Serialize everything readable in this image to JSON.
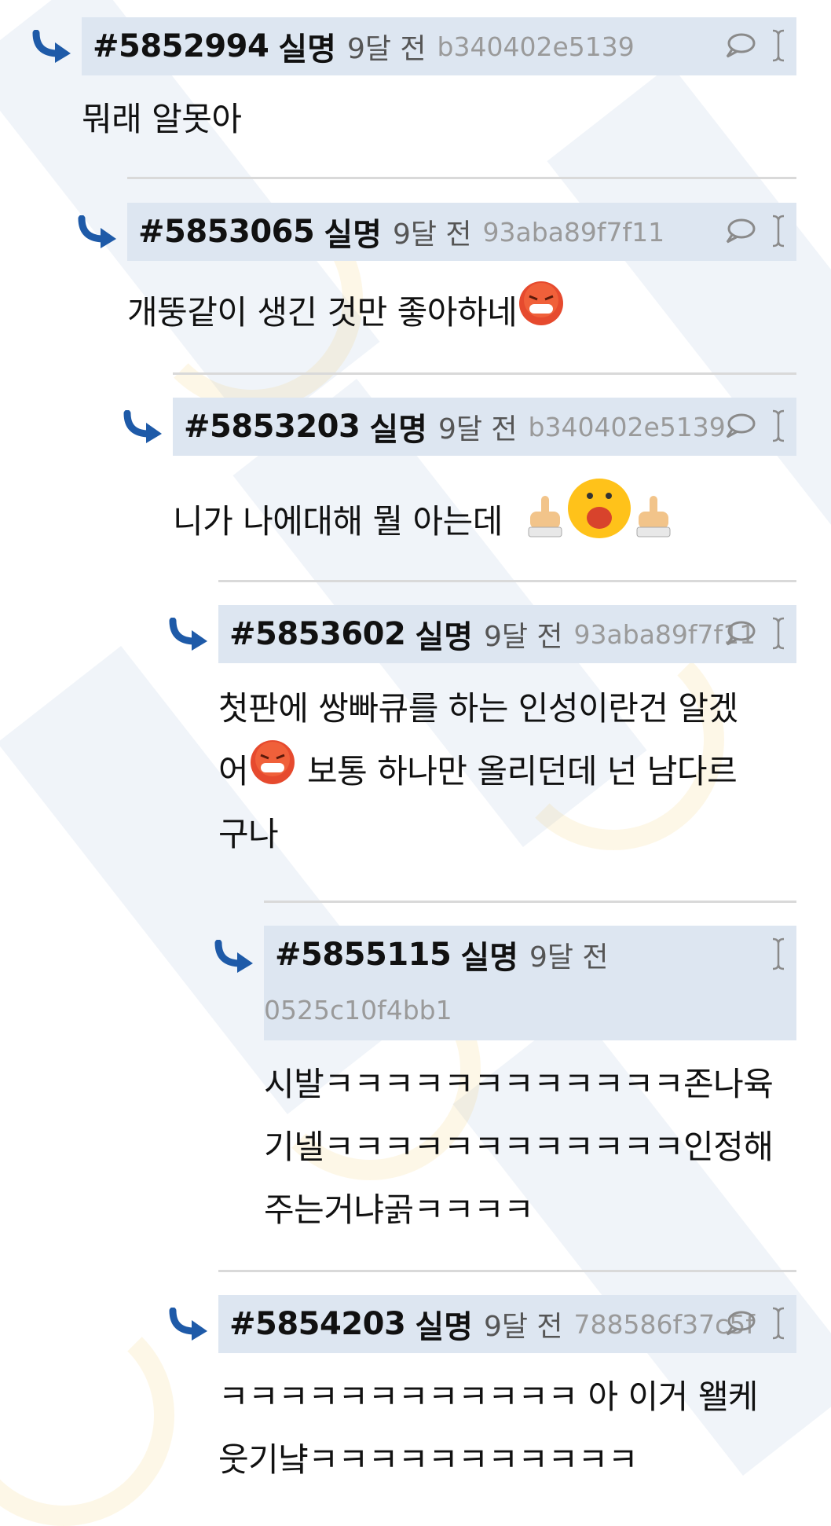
{
  "comments": [
    {
      "id": "#5852994",
      "author": "실명",
      "time": "9달 전",
      "hash": "b340402e5139",
      "text": "뭐래 알못아"
    },
    {
      "id": "#5853065",
      "author": "실명",
      "time": "9달 전",
      "hash": "93aba89f7f11",
      "text": "개뚱같이 생긴 것만 좋아하네"
    },
    {
      "id": "#5853203",
      "author": "실명",
      "time": "9달 전",
      "hash": "b340402e5139",
      "text": "니가 나에대해 뭘 아는데"
    },
    {
      "id": "#5853602",
      "author": "실명",
      "time": "9달 전",
      "hash": "93aba89f7f11",
      "text_line1": "첫판에 쌍빠큐를 하는 인성이란건 알겠",
      "text_line2a": "어",
      "text_line2b": " 보통 하나만 올리던데 넌 남다르",
      "text_line3": "구나"
    },
    {
      "id": "#5855115",
      "author": "실명",
      "time": "9달 전",
      "hash": "0525c10f4bb1",
      "text_line1": "시발ㅋㅋㅋㅋㅋㅋㅋㅋㅋㅋㅋㅋ존나육",
      "text_line2": "기넬ㅋㅋㅋㅋㅋㅋㅋㅋㅋㅋㅋㅋ인정해",
      "text_line3": "주는거냐곩ㅋㅋㅋㅋ"
    },
    {
      "id": "#5854203",
      "author": "실명",
      "time": "9달 전",
      "hash": "788586f37c5f",
      "text_line1": "ㅋㅋㅋㅋㅋㅋㅋㅋㅋㅋㅋㅋ 아 이거 왤케",
      "text_line2": "웃기냨ㅋㅋㅋㅋㅋㅋㅋㅋㅋㅋㅋ"
    }
  ],
  "icons": {
    "reply": "speech-bubble-icon",
    "cursor": "text-cursor-icon",
    "indent": "reply-arrow-icon"
  },
  "colors": {
    "header_bg": "#dde6f1",
    "arrow": "#1e5aa8",
    "hash": "#9a9a9a",
    "separator": "#d9d9d9"
  }
}
